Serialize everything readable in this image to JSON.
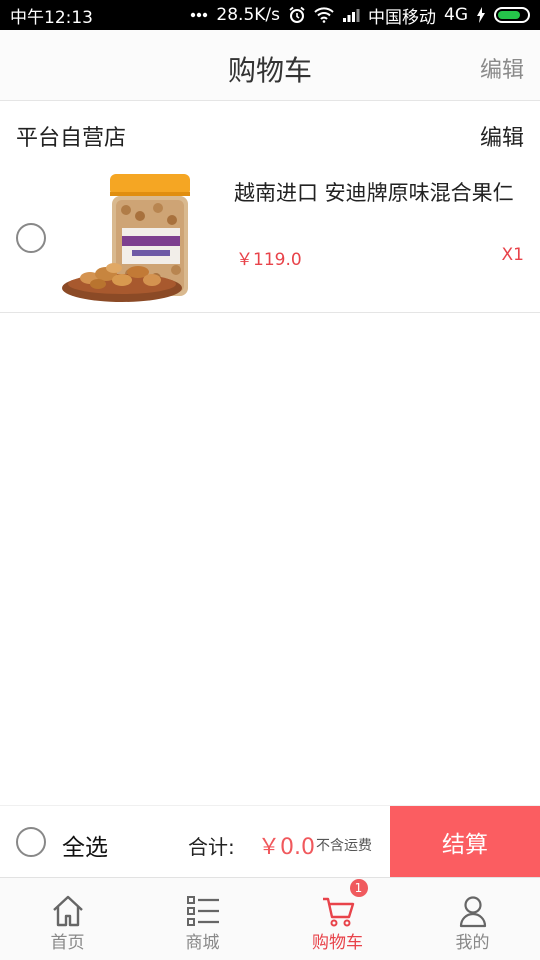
{
  "status_bar": {
    "time": "中午12:13",
    "network_speed": "28.5K/s",
    "carrier": "中国移动",
    "network_type": "4G",
    "icons": [
      "more-dots-icon",
      "alarm-icon",
      "wifi-icon",
      "signal-icon",
      "charging-icon",
      "battery-icon"
    ]
  },
  "header": {
    "title": "购物车",
    "edit_label": "编辑"
  },
  "store": {
    "name": "平台自营店",
    "edit_label": "编辑"
  },
  "cart_items": [
    {
      "name": "越南进口 安迪牌原味混合果仁",
      "price": "￥119.0",
      "quantity": "X1",
      "selected": false
    }
  ],
  "checkout": {
    "select_all_label": "全选",
    "total_label": "合计:",
    "total_amount": "￥0.0",
    "shipping_note": "不含运费",
    "checkout_label": "结算"
  },
  "bottom_nav": {
    "items": [
      {
        "label": "首页",
        "icon": "home-icon"
      },
      {
        "label": "商城",
        "icon": "list-icon"
      },
      {
        "label": "购物车",
        "icon": "cart-icon",
        "badge": "1",
        "active": true
      },
      {
        "label": "我的",
        "icon": "user-icon"
      }
    ]
  },
  "colors": {
    "accent": "#e8434a",
    "checkout_button": "#fb5d61",
    "badge": "#f05a5e"
  }
}
